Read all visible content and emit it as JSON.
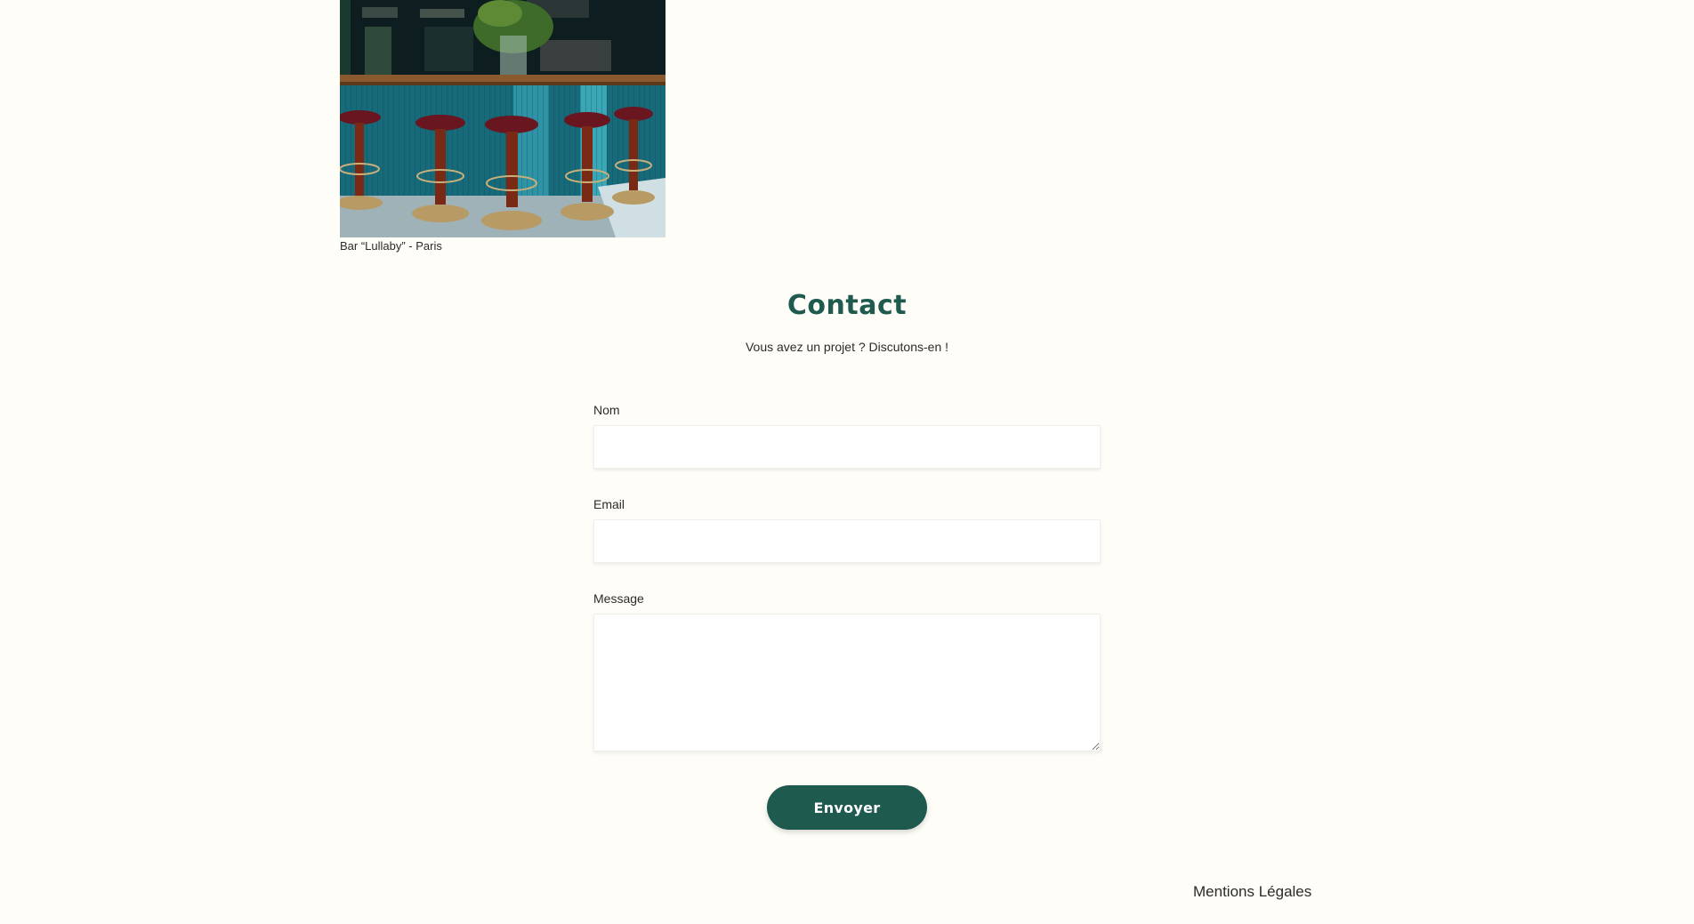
{
  "figure": {
    "image_icon": "bar-interior-photo",
    "caption": "Bar “Lullaby” - Paris"
  },
  "contact": {
    "title": "Contact",
    "subtitle": "Vous avez un projet ? Discutons-en !"
  },
  "form": {
    "name_label": "Nom",
    "name_value": "",
    "email_label": "Email",
    "email_value": "",
    "message_label": "Message",
    "message_value": "",
    "submit_label": "Envoyer"
  },
  "footer": {
    "legal_link": "Mentions Légales"
  },
  "colors": {
    "background": "#fffdf7",
    "accent": "#1f5a4f",
    "text": "#2b2b2b"
  }
}
